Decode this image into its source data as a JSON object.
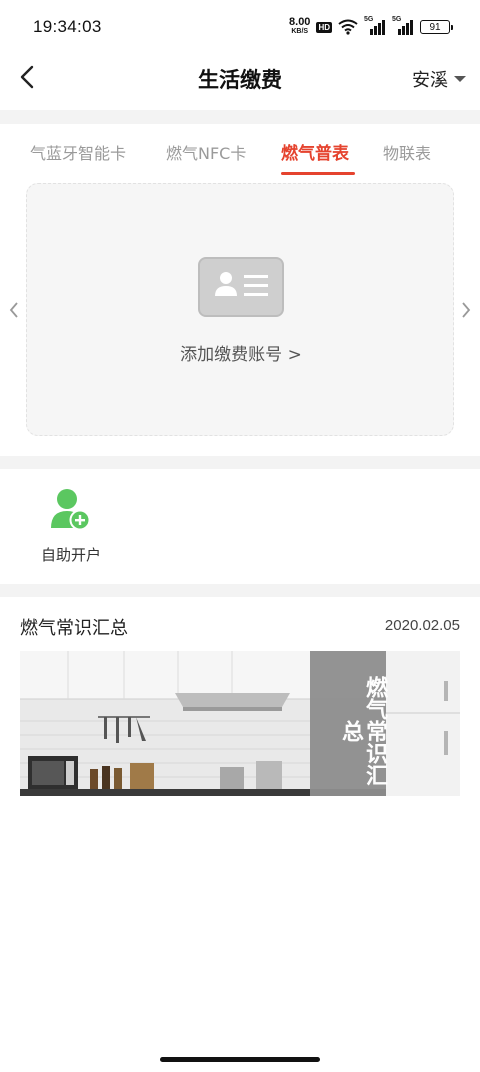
{
  "status_bar": {
    "time": "19:34:03",
    "net_speed_value": "8.00",
    "net_speed_unit": "KB/S",
    "hd_badge": "HD",
    "signal1_tag": "5G",
    "signal2_tag": "5G",
    "battery_level": "91"
  },
  "nav": {
    "title": "生活缴费",
    "city": "安溪"
  },
  "tabs": [
    {
      "label": "气蓝牙智能卡",
      "active": false
    },
    {
      "label": "燃气NFC卡",
      "active": false
    },
    {
      "label": "燃气普表",
      "active": true
    },
    {
      "label": "物联表",
      "active": false
    }
  ],
  "add_card": {
    "label": "添加缴费账号 >"
  },
  "self_service": {
    "label": "自助开户"
  },
  "article": {
    "title": "燃气常识汇总",
    "date": "2020.02.05",
    "banner_text": "燃气常识汇总"
  },
  "colors": {
    "accent": "#e5432e",
    "green": "#5bc760",
    "page_gray": "#f3f3f3"
  }
}
